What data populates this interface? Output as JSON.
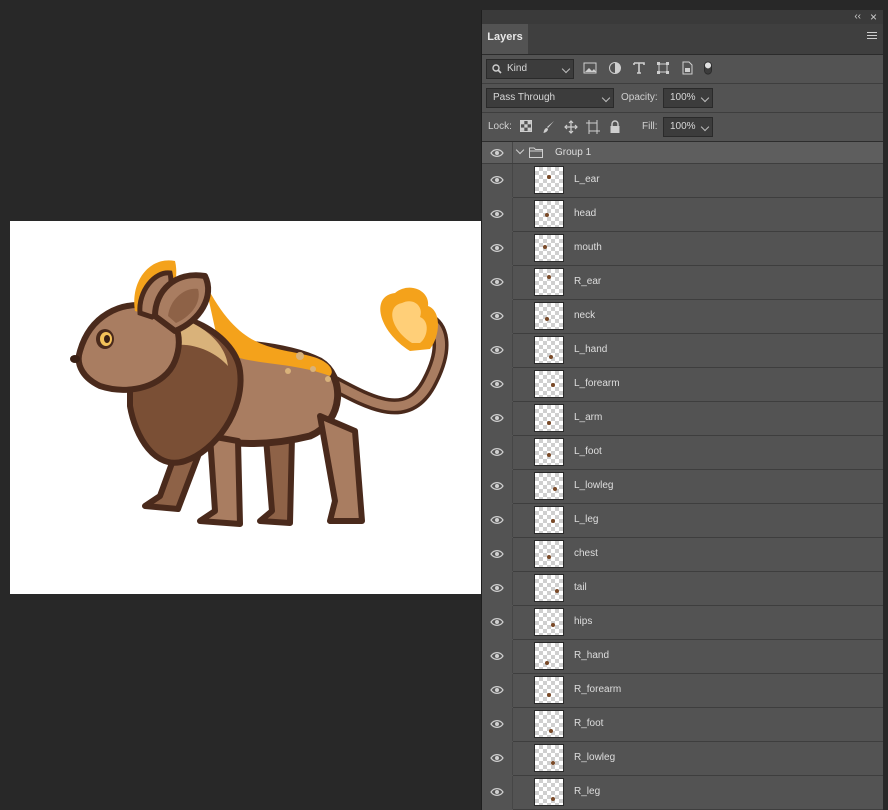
{
  "panel": {
    "tab_label": "Layers",
    "collapse_glyph": "‹‹",
    "close_glyph": "×"
  },
  "filter": {
    "kind_label": "Kind",
    "icons": [
      "image-filter-icon",
      "adjustment-filter-icon",
      "type-filter-icon",
      "shape-filter-icon",
      "smart-object-filter-icon",
      "filter-toggle-icon"
    ]
  },
  "blend": {
    "mode": "Pass Through",
    "opacity_label": "Opacity:",
    "opacity_value": "100%"
  },
  "lock": {
    "label": "Lock:",
    "icons": [
      "lock-transparent-icon",
      "lock-image-icon",
      "lock-position-icon",
      "lock-artboard-icon",
      "lock-all-icon"
    ],
    "fill_label": "Fill:",
    "fill_value": "100%"
  },
  "group": {
    "name": "Group 1"
  },
  "layers": [
    "L_ear",
    "head",
    "mouth",
    "R_ear",
    "neck",
    "L_hand",
    "L_forearm",
    "L_arm",
    "L_foot",
    "L_lowleg",
    "L_leg",
    "chest",
    "tail",
    "hips",
    "R_hand",
    "R_forearm",
    "R_foot",
    "R_lowleg",
    "R_leg"
  ],
  "colors": {
    "app_bg": "#282828",
    "panel_bg": "#535353",
    "creature_fur": "#a97d61",
    "creature_outline": "#4a2a1c",
    "mane_highlight": "#d9b27a",
    "flame_orange": "#f4a21b"
  }
}
